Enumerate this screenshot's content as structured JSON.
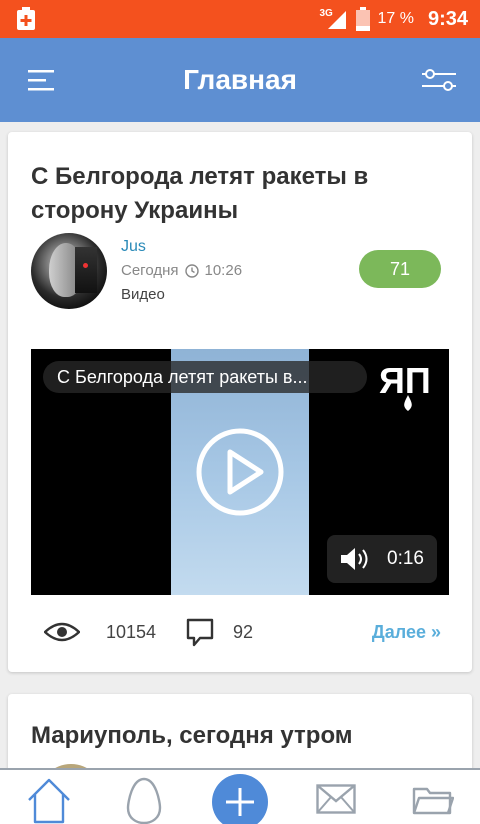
{
  "status_bar": {
    "network": "3G",
    "battery_percent": "17 %",
    "time": "9:34"
  },
  "app_bar": {
    "title": "Главная"
  },
  "posts": [
    {
      "title": "С Белгорода летят ракеты в сторону Украины",
      "author": "Jus",
      "date": "Сегодня",
      "time": "10:26",
      "type": "Видео",
      "rating": "71",
      "video": {
        "title": "С Белгорода летят ракеты в...",
        "logo_text": "ЯП",
        "duration": "0:16"
      },
      "views": "10154",
      "comments": "92",
      "more_label": "Далее »"
    },
    {
      "title": "Мариуполь, сегодня утром"
    }
  ],
  "colors": {
    "status_bar": "#f4511e",
    "app_bar": "#5e8fd2",
    "rating_badge": "#7cb85a",
    "author_link": "#2a8ab8",
    "more_link": "#5aaedb",
    "nav_add_button": "#4f8ad8"
  },
  "bottom_nav": [
    {
      "icon": "home-icon"
    },
    {
      "icon": "egg-icon"
    },
    {
      "icon": "plus-icon"
    },
    {
      "icon": "mail-icon"
    },
    {
      "icon": "folder-icon"
    }
  ]
}
